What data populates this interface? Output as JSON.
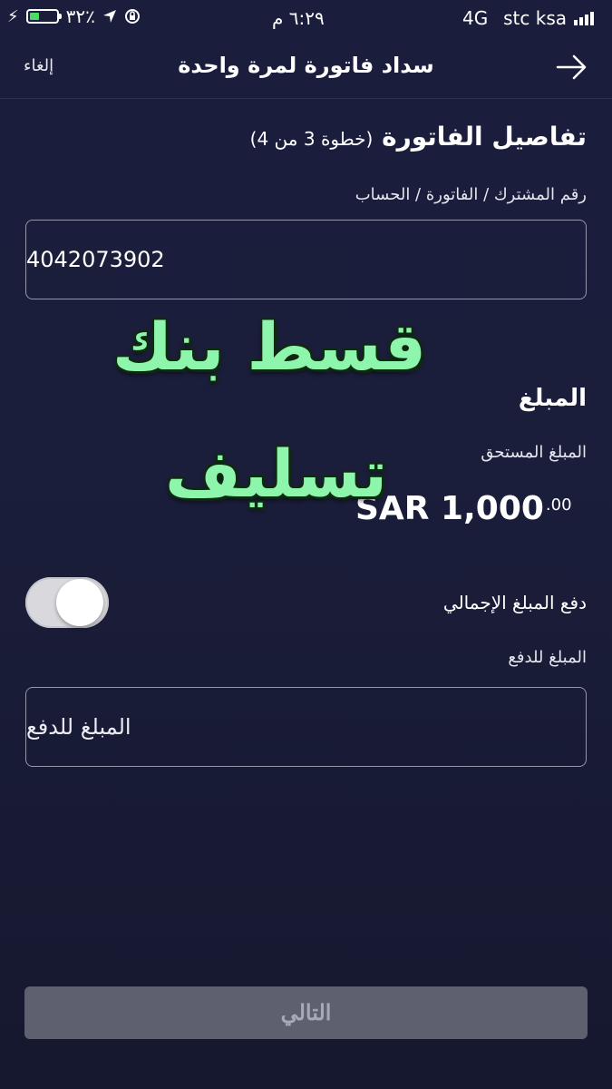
{
  "status_bar": {
    "carrier": "stc ksa",
    "network": "4G",
    "time": "٦:٢٩ م",
    "battery": "٣٢٪",
    "battery_level": 0.32
  },
  "header": {
    "title": "سداد فاتورة لمرة واحدة",
    "cancel_label": "إلغاء",
    "back_icon": "arrow-right-icon"
  },
  "bill_details": {
    "title": "تفاصيل الفاتورة",
    "step": "(خطوة 3 من 4)",
    "subscriber_label": "رقم المشترك / الفاتورة / الحساب",
    "subscriber_value": "4042073902"
  },
  "amount": {
    "title": "المبلغ",
    "due_label": "المبلغ المستحق",
    "due_currency_value": "SAR 1,000",
    "due_decimals": ".00",
    "pay_total_label": "دفع المبلغ الإجمالي",
    "pay_total_enabled": true,
    "pay_amount_label": "المبلغ للدفع",
    "pay_amount_placeholder": "المبلغ للدفع"
  },
  "overlay": {
    "line1": "قسط بنك",
    "line2": "تسليف",
    "color": "#8ef5ad"
  },
  "footer": {
    "next_label": "التالي",
    "next_enabled": false
  }
}
